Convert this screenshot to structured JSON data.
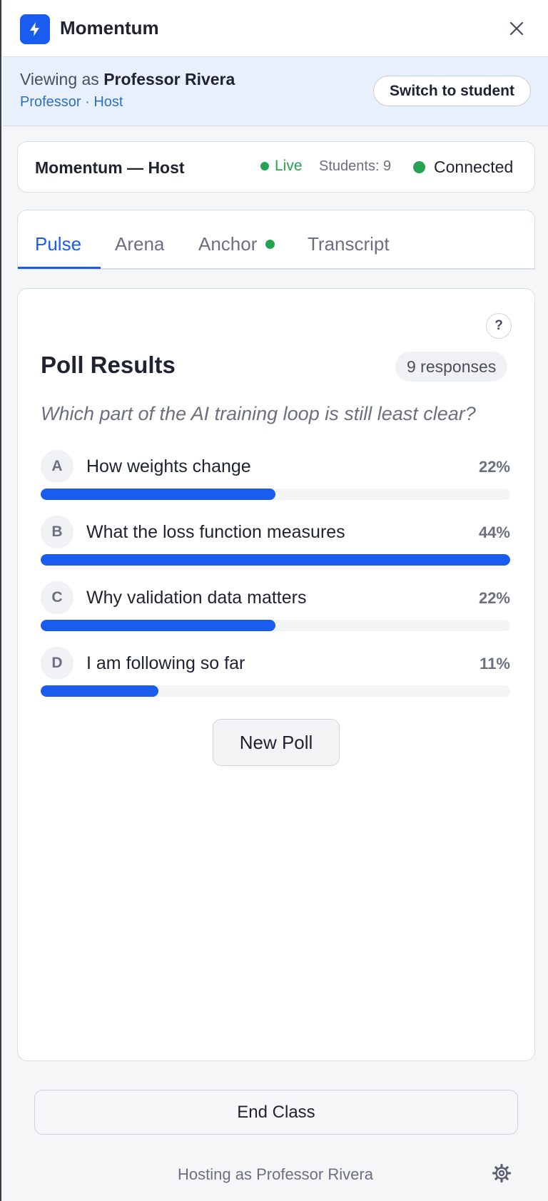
{
  "app": {
    "title": "Momentum"
  },
  "viewing": {
    "prefix": "Viewing as",
    "name": "Professor Rivera",
    "role": "Professor · Host",
    "switch_label": "Switch to student"
  },
  "status": {
    "title": "Momentum — Host",
    "live_label": "Live",
    "students_label": "Students: 9",
    "connection_label": "Connected",
    "status_color": "#26a352"
  },
  "tabs": [
    {
      "label": "Pulse",
      "active": true
    },
    {
      "label": "Arena",
      "active": false
    },
    {
      "label": "Anchor",
      "active": false,
      "indicator": "green-dot"
    },
    {
      "label": "Transcript",
      "active": false
    }
  ],
  "poll": {
    "heading": "Poll Results",
    "responses": "9 responses",
    "question": "Which part of the AI training loop is still least clear?",
    "help_label": "?",
    "options": [
      {
        "letter": "A",
        "label": "How weights change",
        "percent_label": "22%",
        "fill_fraction": 0.5
      },
      {
        "letter": "B",
        "label": "What the loss function measures",
        "percent_label": "44%",
        "fill_fraction": 1.0
      },
      {
        "letter": "C",
        "label": "Why validation data matters",
        "percent_label": "22%",
        "fill_fraction": 0.5
      },
      {
        "letter": "D",
        "label": "I am following so far",
        "percent_label": "11%",
        "fill_fraction": 0.25
      }
    ],
    "new_poll_label": "New Poll"
  },
  "footer": {
    "end_class_label": "End Class",
    "hosting_text": "Hosting as Professor Rivera"
  },
  "colors": {
    "accent": "#1a5cf0",
    "live": "#26a352"
  }
}
